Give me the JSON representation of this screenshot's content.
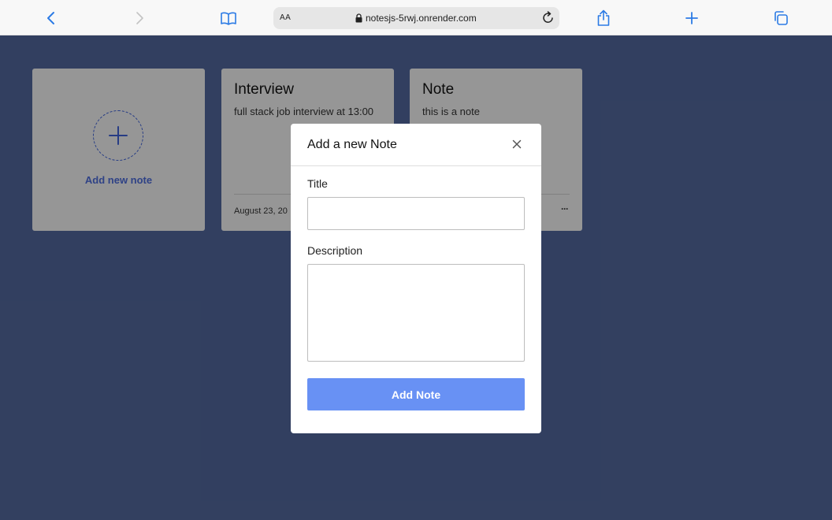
{
  "browser": {
    "text_size_label": "AA",
    "url": "notesjs-5rwj.onrender.com",
    "icons": [
      "back-icon",
      "forward-icon",
      "bookmarks-icon",
      "lock-icon",
      "reload-icon",
      "share-icon",
      "new-tab-icon",
      "tabs-icon"
    ]
  },
  "page": {
    "add_card": {
      "label": "Add new note"
    },
    "notes": [
      {
        "title": "Interview",
        "description": "full stack job interview at 13:00",
        "date": "August 23, 20",
        "more": "···"
      },
      {
        "title": "Note",
        "description": "this is a note",
        "date": "",
        "more": "···"
      }
    ]
  },
  "modal": {
    "title": "Add a new Note",
    "title_label": "Title",
    "title_value": "",
    "description_label": "Description",
    "description_value": "",
    "submit_label": "Add Note"
  },
  "colors": {
    "background": "#52679b",
    "accent": "#6891f4",
    "link": "#4c6bd8"
  }
}
